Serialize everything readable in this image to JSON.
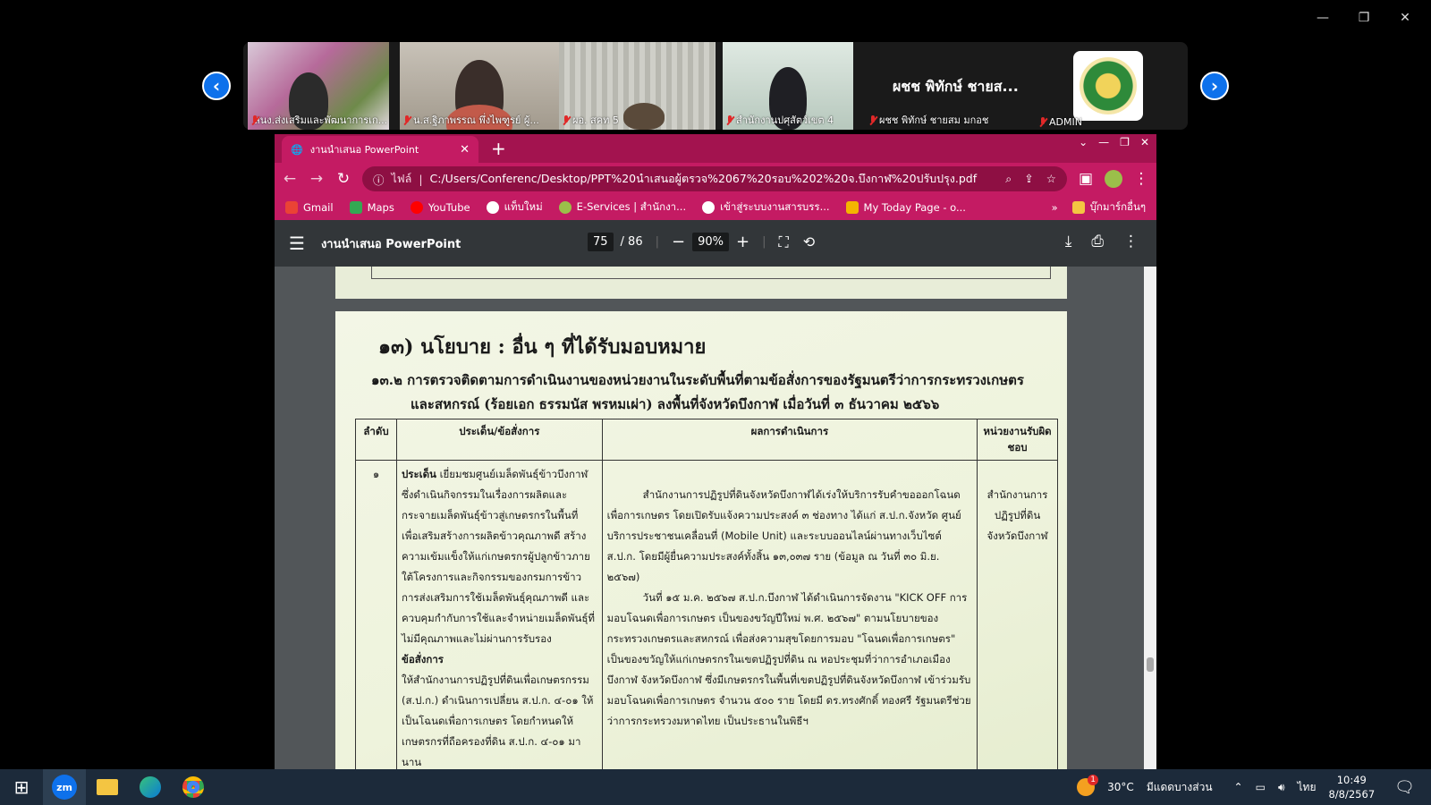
{
  "zoom_gallery": {
    "participants": [
      {
        "name": "สนง.ส่งเสริมและพัฒนาการเก..."
      },
      {
        "name": "น.ส.ฐิภาพรรณ พึ่งไพฑูรย์ ผู้..."
      },
      {
        "name": "ผอ. สคท 5"
      },
      {
        "name": "สำนักงานปศุสัตว์เขต 4"
      },
      {
        "name": "ผชช พิทักษ์ ชายสม มกอช",
        "display_title": "ผชช พิทักษ์ ชายส..."
      },
      {
        "name": "ADMIN"
      }
    ]
  },
  "browser": {
    "tab_title": "งานนำเสนอ PowerPoint",
    "address_scheme": "ไฟล์",
    "address_url": "C:/Users/Conferenc/Desktop/PPT%20นำเสนอผู้ตรวจ%2067%20รอบ%202%20จ.บึงกาฬ%20ปรับปรุง.pdf",
    "bookmarks": [
      "Gmail",
      "Maps",
      "YouTube",
      "แท็บใหม่",
      "E-Services | สำนักงา...",
      "เข้าสู่ระบบงานสารบรร...",
      "My Today Page - o..."
    ],
    "bookmarks_more": "»",
    "other_bookmarks": "บุ๊กมาร์กอื่นๆ"
  },
  "pdf": {
    "title": "งานนำเสนอ PowerPoint",
    "current_page": "75",
    "total_pages": "/  86",
    "zoom": "90%",
    "scroll_fraction": 0.8
  },
  "slide": {
    "heading": "๑๓) นโยบาย : อื่น ๆ ที่ได้รับมอบหมาย",
    "subheading_line1": "๑๓.๒ การตรวจติดตามการดำเนินงานของหน่วยงานในระดับพื้นที่ตามข้อสั่งการของรัฐมนตรีว่าการกระทรวงเกษตร",
    "subheading_line2": "และสหกรณ์ (ร้อยเอก ธรรมนัส พรหมเผ่า) ลงพื้นที่จังหวัดบึงกาฬ เมื่อวันที่ ๓ ธันวาคม ๒๕๖๖",
    "table": {
      "headers": [
        "ลำดับ",
        "ประเด็น/ข้อสั่งการ",
        "ผลการดำเนินการ",
        "หน่วยงานรับผิดชอบ"
      ],
      "row": {
        "no": "๑",
        "issue_label": "ประเด็น",
        "issue_text": "เยี่ยมชมศูนย์เมล็ดพันธุ์ข้าวบึงกาฬ ซึ่งดำเนินกิจกรรมในเรื่องการผลิตและกระจายเมล็ดพันธุ์ข้าวสู่เกษตรกรในพื้นที่ เพื่อเสริมสร้างการผลิตข้าวคุณภาพดี สร้างความเข้มแข็งให้แก่เกษตรกรผู้ปลูกข้าวภายใต้โครงการและกิจกรรมของกรมการข้าว การส่งเสริมการใช้เมล็ดพันธุ์คุณภาพดี และควบคุมกำกับการใช้และจำหน่ายเมล็ดพันธุ์ที่ไม่มีคุณภาพและไม่ผ่านการรับรอง",
        "order_label": "ข้อสั่งการ",
        "order_text": "ให้สำนักงานการปฏิรูปที่ดินเพื่อเกษตรกรรม (ส.ป.ก.) ดำเนินการเปลี่ยน ส.ป.ก. ๔-๐๑ ให้เป็นโฉนดเพื่อการเกษตร โดยกำหนดให้เกษตรกรที่ถือครองที่ดิน ส.ป.ก. ๔-๐๑ มานาน",
        "result_p1": "สำนักงานการปฏิรูปที่ดินจังหวัดบึงกาฬได้เร่งให้บริการรับคำขอออกโฉนดเพื่อการเกษตร โดยเปิดรับแจ้งความประสงค์ ๓ ช่องทาง ได้แก่ ส.ป.ก.จังหวัด ศูนย์บริการประชาชนเคลื่อนที่ (Mobile Unit) และระบบออนไลน์ผ่านทางเว็บไซต์ ส.ป.ก. โดยมีผู้ยื่นความประสงค์ทั้งสิ้น ๑๓,๐๓๗ ราย (ข้อมูล ณ วันที่ ๓๐ มิ.ย. ๒๕๖๗)",
        "result_p2": "วันที่ ๑๕ ม.ค. ๒๕๖๗ ส.ป.ก.บึงกาฬ ได้ดำเนินการจัดงาน \"KICK OFF การมอบโฉนดเพื่อการเกษตร เป็นของขวัญปีใหม่ พ.ศ. ๒๕๖๗\" ตามนโยบายของกระทรวงเกษตรและสหกรณ์ เพื่อส่งความสุขโดยการมอบ \"โฉนดเพื่อการเกษตร\" เป็นของขวัญให้แก่เกษตรกรในเขตปฏิรูปที่ดิน ณ หอประชุมที่ว่าการอำเภอเมือง บึงกาฬ จังหวัดบึงกาฬ ซึ่งมีเกษตรกรในพื้นที่เขตปฏิรูปที่ดินจังหวัดบึงกาฬ เข้าร่วมรับมอบโฉนดเพื่อการเกษตร จำนวน ๕๐๐ ราย โดยมี ดร.ทรงศักดิ์ ทองศรี รัฐมนตรีช่วยว่าการกระทรวงมหาดไทย เป็นประธานในพิธีฯ",
        "agency": "สำนักงานการปฏิรูปที่ดินจังหวัดบึงกาฬ"
      }
    }
  },
  "taskbar": {
    "temperature": "30°C",
    "weather": "มีแดดบางส่วน",
    "weather_badge": "1",
    "language": "ไทย",
    "time": "10:49",
    "date": "8/8/2567"
  }
}
